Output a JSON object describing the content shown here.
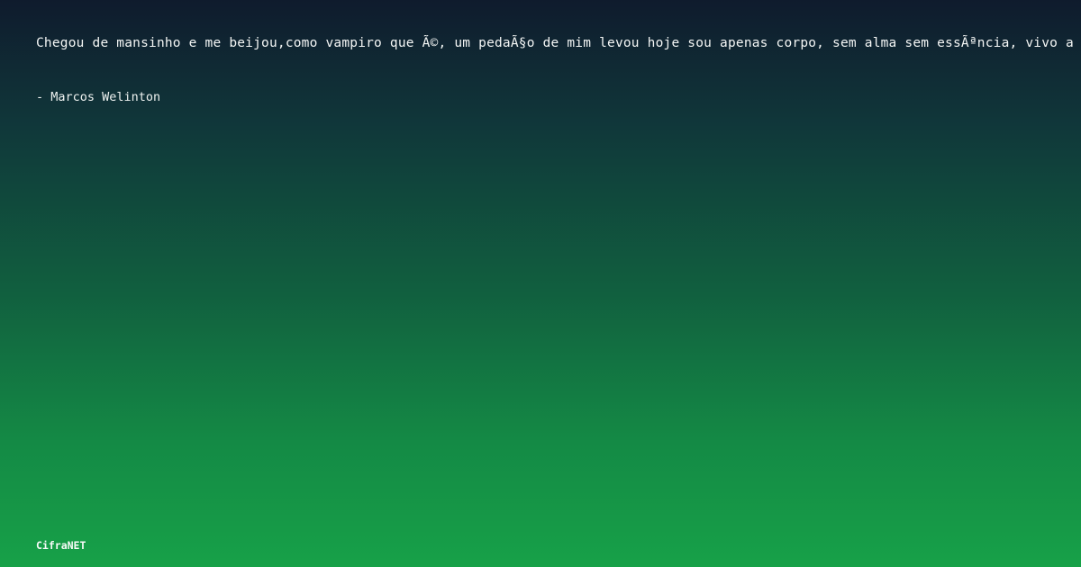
{
  "quote": {
    "text": "Chegou de mansinho e me beijou,como vampiro que Ã©, um pedaÃ§o de mim levou hoje sou apenas corpo, sem alma sem essÃªncia, vivo a"
  },
  "author": {
    "text": "- Marcos Welinton"
  },
  "brand": {
    "text": "CifraNET"
  }
}
